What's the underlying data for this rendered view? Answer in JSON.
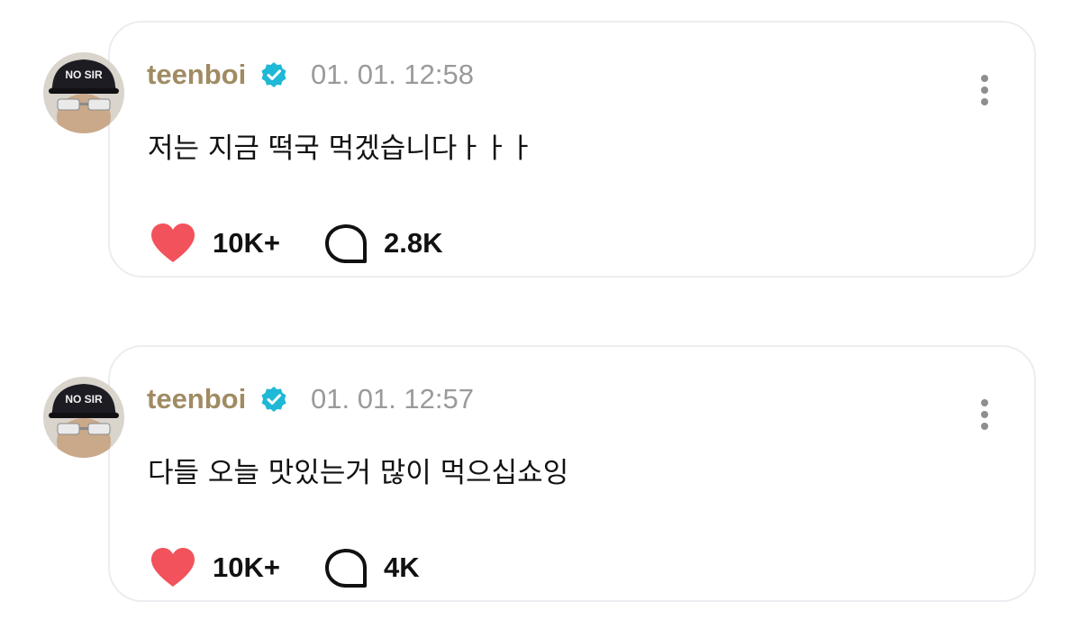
{
  "posts": [
    {
      "username": "teenboi",
      "verified": true,
      "timestamp": "01. 01. 12:58",
      "text": "저는 지금 떡국 먹겠습니다ㅏㅏㅏ",
      "likes": "10K+",
      "comments": "2.8K"
    },
    {
      "username": "teenboi",
      "verified": true,
      "timestamp": "01. 01. 12:57",
      "text": "다들 오늘 맛있는거 많이 먹으십쇼잉",
      "likes": "10K+",
      "comments": "4K"
    }
  ],
  "colors": {
    "username": "#a08b63",
    "verified_badge": "#1fb8d6",
    "heart": "#f2525b",
    "timestamp": "#9a9a9a",
    "card_border": "#ececf1"
  },
  "icons": {
    "verified": "verified-badge-icon",
    "like": "heart-icon",
    "comment": "speech-bubble-icon",
    "more": "vertical-dots-icon"
  }
}
